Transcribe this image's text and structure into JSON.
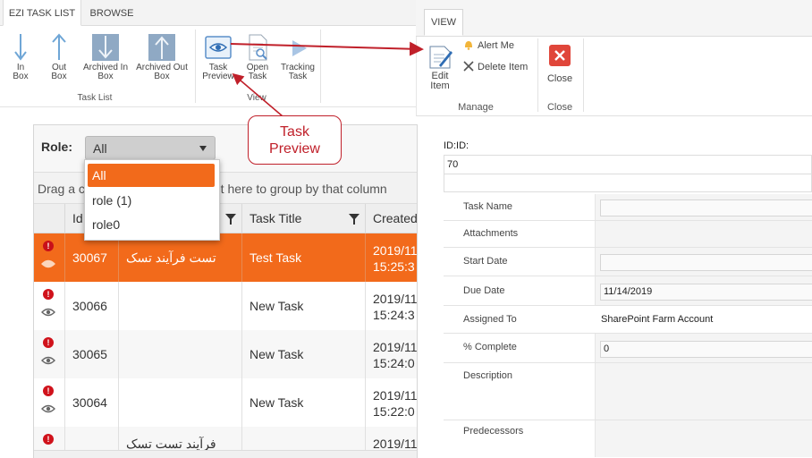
{
  "ribbon": {
    "tabs": [
      "EZI TASK LIST",
      "BROWSE"
    ],
    "buttons": {
      "in_box": [
        "In",
        "Box"
      ],
      "out_box": [
        "Out",
        "Box"
      ],
      "archived_in_box": [
        "Archived In",
        "Box"
      ],
      "archived_out_box": [
        "Archived Out",
        "Box"
      ],
      "task_preview": [
        "Task",
        "Preview"
      ],
      "open_task": [
        "Open",
        "Task"
      ],
      "tracking_task": [
        "Tracking",
        "Task"
      ]
    },
    "groups": {
      "task_list": "Task List",
      "view": "View"
    }
  },
  "callout": {
    "line1": "Task",
    "line2": "Preview"
  },
  "grid": {
    "role_label": "Role:",
    "role_selected": "All",
    "role_options": [
      "All",
      "role (1)",
      "role0"
    ],
    "group_hint": "Drag a column header and drop it here to group by that column",
    "columns": {
      "id": "Id",
      "task_title": "Task Title",
      "created": "Created"
    },
    "rows": [
      {
        "id": "30067",
        "name": "تست فرآیند تسک",
        "title": "Test Task",
        "created1": "2019/11",
        "created2": "15:25:3"
      },
      {
        "id": "30066",
        "name": "",
        "title": "New Task",
        "created1": "2019/11",
        "created2": "15:24:3"
      },
      {
        "id": "30065",
        "name": "",
        "title": "New Task",
        "created1": "2019/11",
        "created2": "15:24:0"
      },
      {
        "id": "30064",
        "name": "",
        "title": "New Task",
        "created1": "2019/11",
        "created2": "15:22:0"
      },
      {
        "id": "",
        "name": "فرآیند تست تسک",
        "title": "",
        "created1": "2019/11",
        "created2": ""
      }
    ]
  },
  "view_ribbon": {
    "tab": "VIEW",
    "edit_item": [
      "Edit",
      "Item"
    ],
    "alert_me": "Alert Me",
    "delete_item": "Delete Item",
    "close": "Close",
    "groups": {
      "manage": "Manage",
      "close": "Close"
    }
  },
  "form": {
    "id_label": "ID:ID:",
    "id_value": "70",
    "fields": {
      "task_name": "Task Name",
      "attachments": "Attachments",
      "start_date": "Start Date",
      "due_date": "Due Date",
      "due_date_value": "11/14/2019",
      "assigned_to": "Assigned To",
      "assigned_to_value": "SharePoint Farm Account",
      "percent_complete": "% Complete",
      "percent_complete_value": "0",
      "description": "Description",
      "predecessors": "Predecessors"
    }
  },
  "colors": {
    "accent": "#f26a1b",
    "callout": "#c0202a",
    "close_red": "#e0463a",
    "icon_blue": "#5b8fc9"
  }
}
